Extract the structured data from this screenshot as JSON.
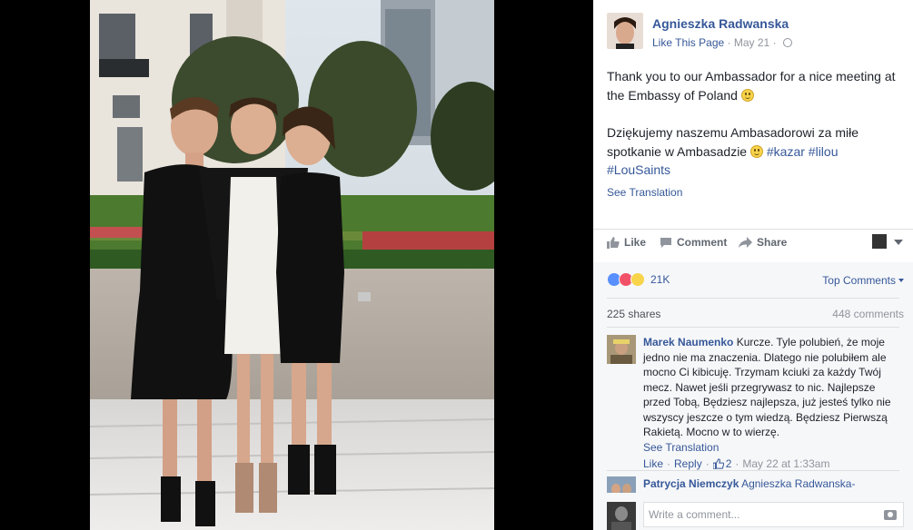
{
  "post": {
    "author": "Agnieszka Radwanska",
    "like_page": "Like This Page",
    "separator": "·",
    "date": "May 21",
    "dot": "·",
    "text_en": "Thank you to our Ambassador for a nice meeting at the Embassy of Poland",
    "text_pl": "Dziękujemy naszemu Ambasadorowi za miłe spotkanie w Ambasadzie",
    "tag1": "#kazar",
    "tag2": "#lilou",
    "tag3": "#LouSaints",
    "see_translation": "See Translation"
  },
  "actions": {
    "like": "Like",
    "comment": "Comment",
    "share": "Share"
  },
  "feedback": {
    "reaction_count": "21K",
    "top_comments": "Top Comments",
    "shares": "225 shares",
    "comments_count": "448 comments"
  },
  "comments": [
    {
      "name": "Marek Naumenko",
      "text": "Kurcze. Tyle polubień, że moje jedno nie ma znaczenia. Dlatego nie polubiłem ale mocno Ci kibicuję. Trzymam kciuki za każdy Twój mecz. Nawet jeśli przegrywasz to nic. Najlepsze przed Tobą, Będziesz najlepsza, już jesteś tylko nie wszyscy jeszcze o tym wiedzą. Będziesz Pierwszą Rakietą. Mocno w to wierzę.",
      "see_translation": "See Translation",
      "like": "Like",
      "reply": "Reply",
      "likes": "2",
      "time": "May 22 at 1:33am"
    },
    {
      "name": "Patrycja Niemczyk",
      "mention": "Agnieszka Radwanska-"
    }
  ],
  "reply_box": {
    "placeholder": "Write a comment..."
  },
  "colors": {
    "link": "#365899",
    "muted": "#90949c",
    "panel_bg": "#f6f7f9"
  }
}
